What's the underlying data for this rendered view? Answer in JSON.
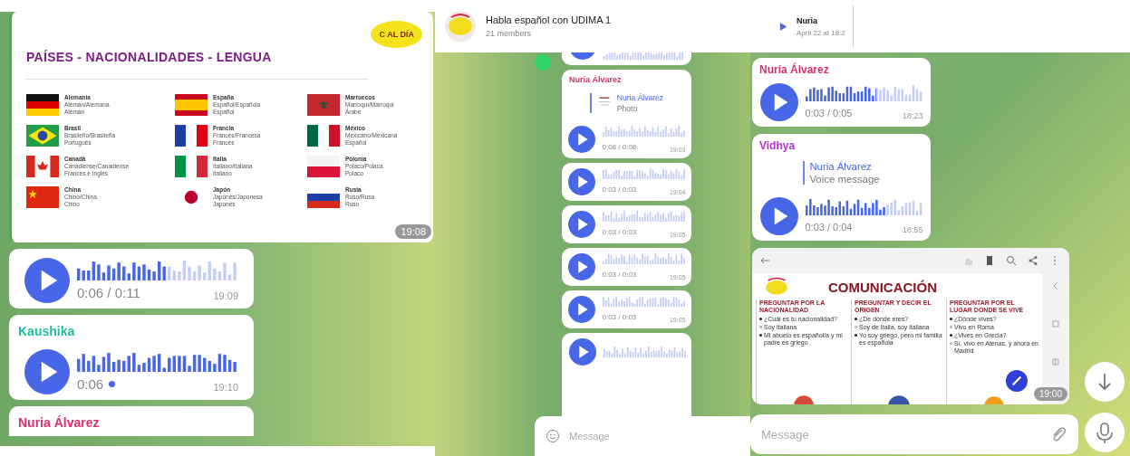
{
  "panels": [
    {
      "messages": [
        {
          "kind": "poster",
          "title": "PAÍSES - NACIONALIDADES - LENGUA",
          "logo": "C AL DÍA",
          "time": "19:08",
          "countries": [
            {
              "kind": "de",
              "country": "Alemania",
              "nationality": "Alemán/Alemana",
              "language": "Alemán"
            },
            {
              "kind": "es",
              "country": "España",
              "nationality": "Español/Española",
              "language": "Español"
            },
            {
              "kind": "ma",
              "country": "Marruecos",
              "nationality": "Marroquí/Marroquí",
              "language": "Árabe"
            },
            {
              "kind": "br",
              "country": "Brasil",
              "nationality": "Brasileño/Brasileña",
              "language": "Portugués"
            },
            {
              "kind": "fr",
              "country": "Francia",
              "nationality": "Francés/Francesa",
              "language": "Francés"
            },
            {
              "kind": "mx",
              "country": "México",
              "nationality": "Mexicano/Mexicana",
              "language": "Español"
            },
            {
              "kind": "ca",
              "country": "Canadá",
              "nationality": "Canadiense/Canadiense",
              "language": "Francés e Inglés"
            },
            {
              "kind": "it",
              "country": "Italia",
              "nationality": "Italiano/Italiana",
              "language": "Italiano"
            },
            {
              "kind": "pl",
              "country": "Polonia",
              "nationality": "Polaco/Polaca",
              "language": "Polaco"
            },
            {
              "kind": "cn",
              "country": "China",
              "nationality": "Chino/China",
              "language": "Chino"
            },
            {
              "kind": "jp",
              "country": "Japón",
              "nationality": "Japonés/Japonesa",
              "language": "Japonés"
            },
            {
              "kind": "ru",
              "country": "Rusia",
              "nationality": "Ruso/Rusa",
              "language": "Ruso"
            }
          ]
        },
        {
          "kind": "voice",
          "duration": "0:06 / 0:11",
          "level": 0.55,
          "time": "19:09"
        },
        {
          "kind": "voice",
          "sender": "Kaushika",
          "color": "#1fbf9c",
          "duration": "0:06",
          "level": 1,
          "unread": true,
          "time": "19:10"
        },
        {
          "kind": "cut-bottom",
          "sender": "Nuria Álvarez",
          "color": "#d8306e"
        }
      ]
    },
    {
      "header": {
        "title": "Habla español con UDIMA 1",
        "subtitle": "21 members"
      },
      "messages": [
        {
          "kind": "cut-top",
          "avatar": true
        },
        {
          "kind": "voice",
          "sender": "Nuria Álvarez",
          "color": "#d8306e",
          "reply": {
            "name": "Nuria Álvarez",
            "text": "Photo",
            "thumbnail": true
          },
          "duration": "0:08 / 0:08",
          "time": "19:03"
        },
        {
          "kind": "voice",
          "duration": "0:03 / 0:03",
          "time": "19:04"
        },
        {
          "kind": "voice",
          "duration": "0:03 / 0:03",
          "time": "19:05"
        },
        {
          "kind": "voice",
          "duration": "0:03 / 0:03",
          "time": "19:05"
        },
        {
          "kind": "voice",
          "duration": "0:03 / 0:03",
          "time": "19:05"
        },
        {
          "kind": "cut-bottom"
        }
      ],
      "composer": {
        "placeholder": "Message"
      }
    },
    {
      "header": {
        "pinned": {
          "name": "Nuria",
          "text": "April 22 at 18:2"
        }
      },
      "messages": [
        {
          "kind": "voice",
          "sender": "Nuria Álvarez",
          "color": "#d8306e",
          "duration": "0:03 / 0:05",
          "level": 0.6,
          "time": "18:23"
        },
        {
          "kind": "voice",
          "sender": "Vidhya",
          "color": "#b82fd0",
          "reply": {
            "name": "Nuria Álvarez",
            "text": "Voice message"
          },
          "duration": "0:03 / 0:04",
          "level": 0.68,
          "time": "18:55"
        },
        {
          "kind": "document",
          "title": "COMUNICACIÓN",
          "time": "19:00",
          "columns": [
            {
              "heading": "PREGUNTAR POR LA NACIONALIDAD",
              "lines": [
                {
                  "kind": "question",
                  "text": "¿Cuál es tu nacionalidad?"
                },
                {
                  "kind": "answer",
                  "text": "Soy italiana"
                },
                {
                  "kind": "question",
                  "text": "Mi abuelo es español/a y mi padre es griego"
                }
              ]
            },
            {
              "heading": "PREGUNTAR Y DECIR EL ORIGEN",
              "lines": [
                {
                  "kind": "question",
                  "text": "¿De dónde eres?"
                },
                {
                  "kind": "answer",
                  "text": "Soy de Italia, soy italiana"
                },
                {
                  "kind": "question",
                  "text": "Yo soy griego, pero mi familia es española"
                }
              ]
            },
            {
              "heading": "PREGUNTAR POR EL LUGAR DONDE SE VIVE",
              "lines": [
                {
                  "kind": "question",
                  "text": "¿Dónde vives?"
                },
                {
                  "kind": "answer",
                  "text": "Vivo en Roma"
                },
                {
                  "kind": "question",
                  "text": "¿Vives en Grecia?"
                },
                {
                  "kind": "answer",
                  "text": "Sí, vivo en Atenas, y ahora en Madrid"
                }
              ]
            }
          ]
        }
      ],
      "composer": {
        "placeholder": "Message"
      }
    }
  ]
}
